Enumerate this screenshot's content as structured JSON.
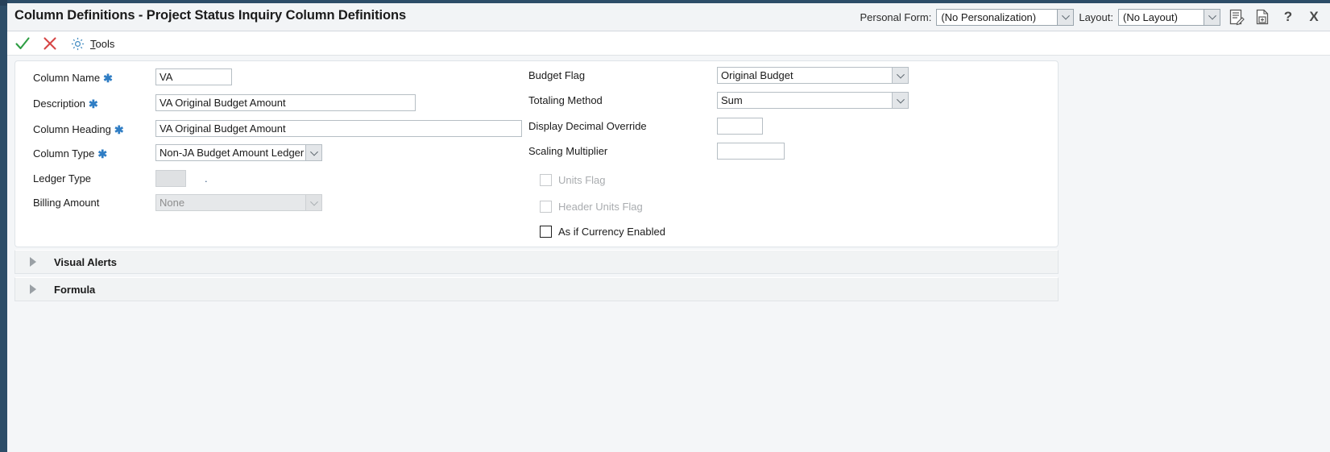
{
  "window": {
    "title": "Column Definitions - Project Status Inquiry Column Definitions"
  },
  "titlebar": {
    "personal_form_label": "Personal Form:",
    "personal_form_value": "(No Personalization)",
    "layout_label": "Layout:",
    "layout_value": "(No Layout)",
    "icons": [
      {
        "name": "form-edit-icon",
        "glyph": "ὍD"
      },
      {
        "name": "save-as-icon",
        "glyph": ""
      },
      {
        "name": "help-icon",
        "glyph": "?"
      },
      {
        "name": "close-icon",
        "glyph": "X"
      }
    ]
  },
  "toolbar": {
    "ok_label": "OK",
    "cancel_label": "Cancel",
    "tools_mnemonic": "T",
    "tools_rest": "ools"
  },
  "form": {
    "left_fields": [
      {
        "label": "Column Name",
        "required": true,
        "control": "text",
        "value": "VA"
      },
      {
        "label": "Description",
        "required": true,
        "control": "text",
        "value": "VA Original Budget Amount"
      },
      {
        "label": "Column Heading",
        "required": true,
        "control": "text",
        "value": "VA Original Budget Amount"
      },
      {
        "label": "Column Type",
        "required": true,
        "control": "dropdown",
        "value": "Non-JA Budget Amount Ledger"
      },
      {
        "label": "Ledger Type",
        "required": false,
        "control": "text-disabled",
        "value": "",
        "suffix": "."
      },
      {
        "label": "Billing Amount",
        "required": false,
        "control": "dropdown-disabled",
        "value": "None"
      }
    ],
    "right_fields": [
      {
        "label": "Budget Flag",
        "required": false,
        "control": "dropdown",
        "value": "Original Budget"
      },
      {
        "label": "Totaling Method",
        "required": false,
        "control": "dropdown",
        "value": "Sum"
      },
      {
        "label": "Display Decimal Override",
        "required": false,
        "control": "text",
        "value": ""
      },
      {
        "label": "Scaling Multiplier",
        "required": false,
        "control": "text",
        "value": ""
      }
    ],
    "checkboxes": [
      {
        "label": "Units Flag",
        "checked": false,
        "disabled": true
      },
      {
        "label": "Header Units Flag",
        "checked": false,
        "disabled": true
      },
      {
        "label": "As if Currency Enabled",
        "checked": false,
        "disabled": false
      }
    ]
  },
  "sections": [
    {
      "label": "Visual Alerts",
      "expanded": false
    },
    {
      "label": "Formula",
      "expanded": false
    }
  ],
  "sidebar": {
    "collapse_glyph": "«"
  },
  "colors": {
    "rail": "#2d4d68",
    "required_star": "#2f7dc4",
    "ok_check": "#2f9e44",
    "cancel_x": "#d64545",
    "gear": "#4a90c4"
  }
}
